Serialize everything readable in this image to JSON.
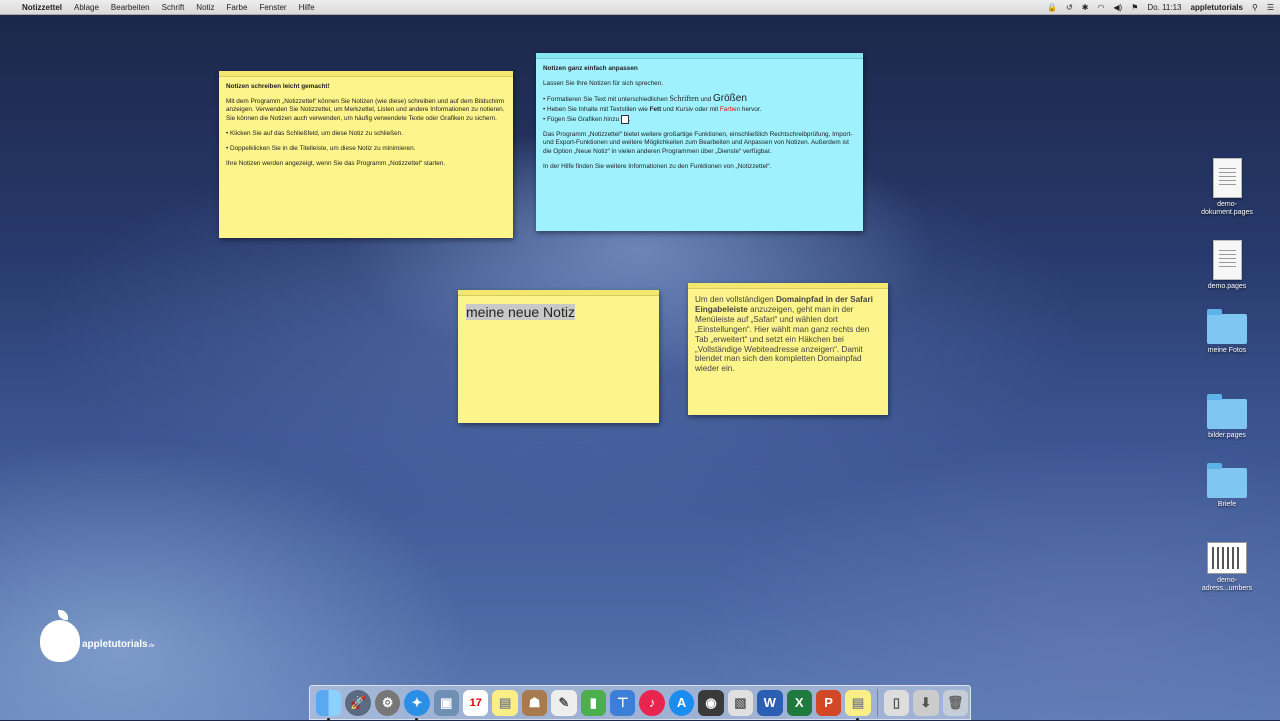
{
  "menubar": {
    "app_name": "Notizzettel",
    "menus": [
      "Ablage",
      "Bearbeiten",
      "Schrift",
      "Notiz",
      "Farbe",
      "Fenster",
      "Hilfe"
    ],
    "clock": "Do. 11:13",
    "user": "appletutorials",
    "status_icons": [
      "lock-icon",
      "time-machine-icon",
      "bluetooth-icon",
      "wifi-icon",
      "volume-icon",
      "flag-icon",
      "search-icon",
      "list-icon"
    ]
  },
  "notes": {
    "note1": {
      "color": "#fdf48b",
      "title": "Notizen schreiben leicht gemacht!",
      "p1": "Mit dem Programm „Notizzettel“ können Sie Notizen (wie diese) schreiben und auf dem Bildschirm anzeigen. Verwenden Sie Notizzettel, um Merkzettel, Listen und andere Informationen zu notieren. Sie können die Notizen auch verwenden, um häufig verwendete Texte oder Grafiken zu sichern.",
      "p2": "• Klicken Sie auf das Schließfeld, um diese Notiz zu schließen.",
      "p3": "• Doppelklicken Sie in die Titelleiste, um diese Notiz zu minimieren.",
      "p4": "Ihre Notizen werden angezeigt, wenn Sie das Programm „Notizzettel“ starten."
    },
    "note2": {
      "color": "#9ef1fd",
      "title": "Notizen ganz einfach anpassen",
      "intro": "Lassen Sie Ihre Notizen für sich sprechen.",
      "li1_a": "• Formatieren Sie Text mit unterschiedlichen ",
      "li1_b": "Schriften",
      "li1_c": " und ",
      "li1_d": "Größen",
      "li2_a": "• Heben Sie Inhalte mit Textstilen wie ",
      "li2_b": "Fett",
      "li2_c": " und ",
      "li2_d": "Kursiv",
      "li2_e": " oder mit ",
      "li2_f": "Farben",
      "li2_g": " hervor.",
      "li3": "• Fügen Sie Grafiken hinzu",
      "p2": "Das Programm „Notizzettel“ bietet weitere großartige Funktionen, einschließlich Rechtschreibprüfung, Import- und Export-Funktionen und weitere Möglichkeiten zum Bearbeiten und Anpassen von Notizen. Außerdem ist die Option „Neue Notiz“ in vielen anderen Programmen über „Dienste“ verfügbar.",
      "p3": "In der Hilfe finden Sie weitere Informationen zu den Funktionen von „Notizzettel“."
    },
    "note3": {
      "color": "#fdf48b",
      "text": "meine neue Notiz"
    },
    "note4": {
      "color": "#fdf48b",
      "t1": "Um den vollständigen ",
      "t2": "Domainpfad in der Safari Eingabeleiste",
      "t3": " anzuzeigen, geht man in der Menüleiste auf „Safari“ und wählen dort „Einstellungen“. Hier wählt man ganz rechts den Tab „erweitert“ und setzt ein Häkchen bei „Vollständige Webiteadresse anzeigen“. Damit blendet man sich den kompletten Domainpfad wieder ein."
    }
  },
  "desktop_icons": [
    {
      "label": "demo-\ndokument.pages",
      "type": "doc"
    },
    {
      "label": "demo.pages",
      "type": "doc"
    },
    {
      "label": "meine Fotos",
      "type": "folder"
    },
    {
      "label": "bilder.pages",
      "type": "folder"
    },
    {
      "label": "Briefe",
      "type": "folder"
    },
    {
      "label": "demo-\nadress...umbers",
      "type": "sheet"
    }
  ],
  "logo": {
    "name": "appletutorials",
    "suffix": ".de"
  },
  "dock": {
    "apps": [
      "Finder",
      "Launchpad",
      "Systemeinstellungen",
      "Safari",
      "Vorschau",
      "Kalender",
      "Notizzettel",
      "Kontakte",
      "TextEdit",
      "Numbers",
      "Keynote",
      "iTunes",
      "App Store",
      "Sprachmemos",
      "Preview",
      "Word",
      "Excel",
      "PowerPoint",
      "Notizzettel 2",
      "Dokumente",
      "Downloads",
      "Papierkorb"
    ]
  }
}
